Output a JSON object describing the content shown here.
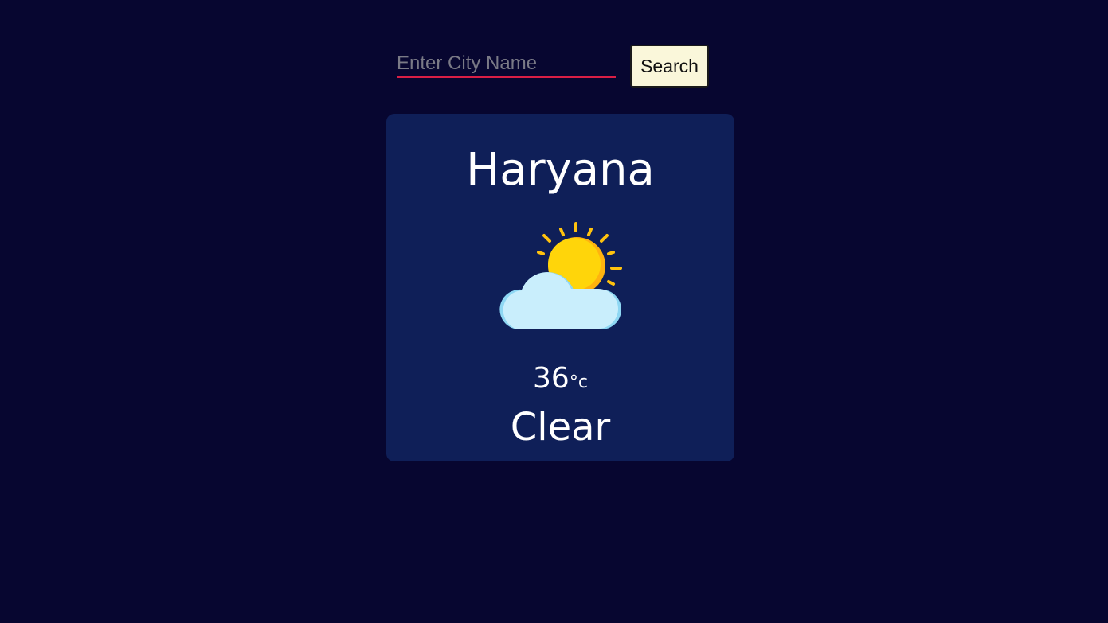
{
  "search": {
    "placeholder": "Enter City Name",
    "value": "",
    "button_label": "Search"
  },
  "weather": {
    "city": "Haryana",
    "icon": "partly-cloudy-icon",
    "temperature": "36",
    "unit": "°c",
    "condition": "Clear"
  },
  "colors": {
    "background": "#070630",
    "card": "#0f1f58",
    "input_underline": "#d91e45",
    "button_bg": "#faf7da",
    "sun": "#ffd50a",
    "cloud": "#c9eefc"
  }
}
